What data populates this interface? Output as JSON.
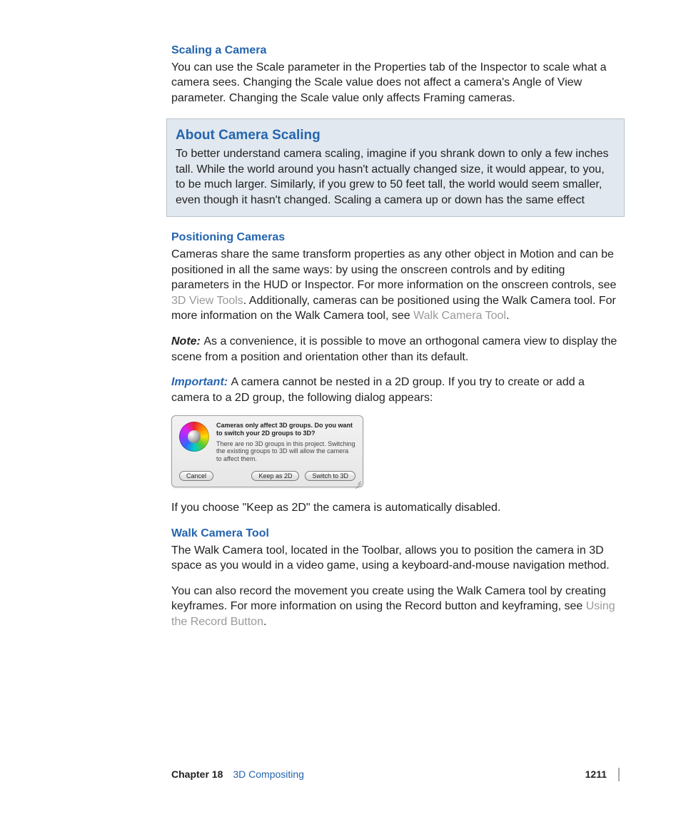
{
  "section1": {
    "heading": "Scaling a Camera",
    "body": "You can use the Scale parameter in the Properties tab of the Inspector to scale what a camera sees. Changing the Scale value does not affect a camera's Angle of View parameter. Changing the Scale value only affects Framing cameras."
  },
  "callout": {
    "title": "About Camera Scaling",
    "body": "To better understand camera scaling, imagine if you shrank down to only a few inches tall. While the world around you hasn't actually changed size, it would appear, to you, to be much larger. Similarly, if you grew to 50 feet tall, the world would seem smaller, even though it hasn't changed. Scaling a camera up or down has the same effect"
  },
  "section2": {
    "heading": "Positioning Cameras",
    "p1a": "Cameras share the same transform properties as any other object in Motion and can be positioned in all the same ways: by using the onscreen controls and by editing parameters in the HUD or Inspector. For more information on the onscreen controls, see ",
    "link1": "3D View Tools",
    "p1b": ". Additionally, cameras can be positioned using the Walk Camera tool. For more information on the Walk Camera tool, see ",
    "link2": "Walk Camera Tool",
    "p1c": ".",
    "note_label": "Note:  ",
    "note_body": "As a convenience, it is possible to move an orthogonal camera view to display the scene from a position and orientation other than its default.",
    "important_label": "Important:  ",
    "important_body": "A camera cannot be nested in a 2D group. If you try to create or add a camera to a 2D group, the following dialog appears:"
  },
  "dialog": {
    "main": "Cameras only affect 3D groups. Do you want to switch your 2D  groups to 3D?",
    "sub": "There are no 3D groups in this project. Switching the existing groups to 3D will allow the camera to affect them.",
    "btn_cancel": "Cancel",
    "btn_keep": "Keep as 2D",
    "btn_switch": "Switch to 3D"
  },
  "section2b": {
    "after_dialog": "If you choose \"Keep as 2D\" the camera is automatically disabled."
  },
  "section3": {
    "heading": "Walk Camera Tool",
    "p1": "The Walk Camera tool, located in the Toolbar, allows you to position the camera in 3D space as you would in a video game, using a keyboard-and-mouse navigation method.",
    "p2a": "You can also record the movement you create using the Walk Camera tool by creating keyframes. For more information on using the Record button and keyframing, see ",
    "link": "Using the Record Button",
    "p2b": "."
  },
  "footer": {
    "chapter": "Chapter 18",
    "title": "3D Compositing",
    "page": "1211"
  }
}
